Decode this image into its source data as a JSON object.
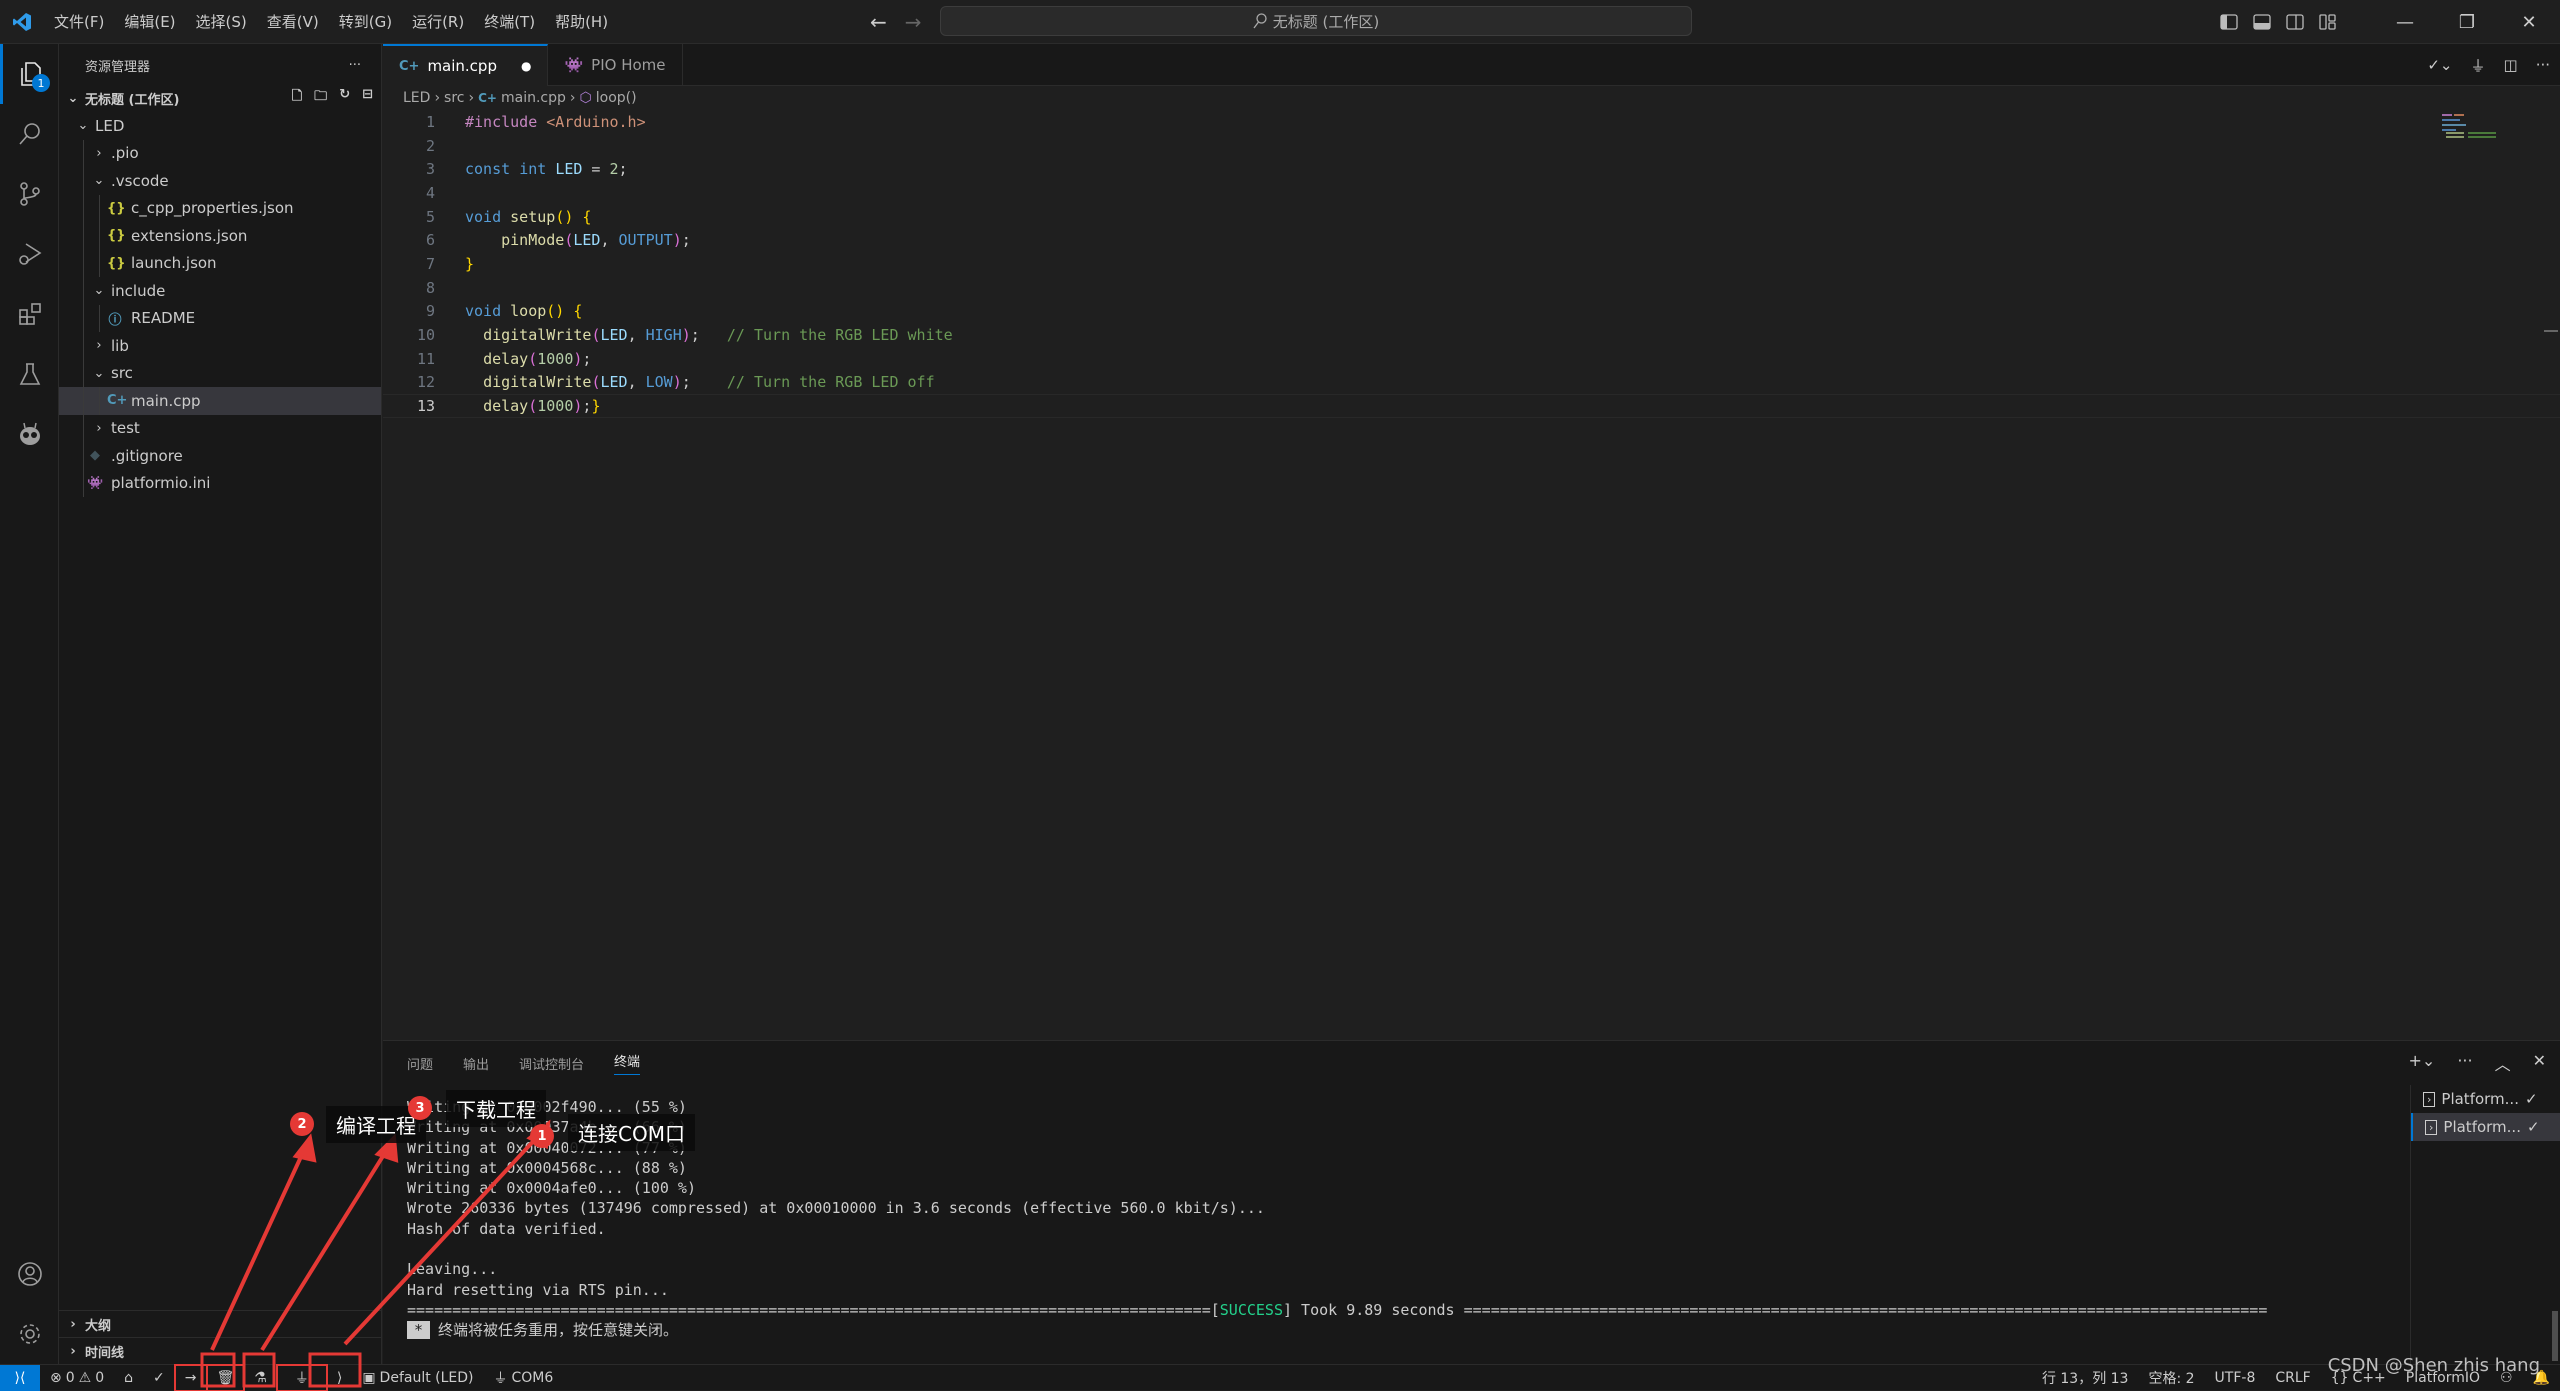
{
  "menu": [
    "文件(F)",
    "编辑(E)",
    "选择(S)",
    "查看(V)",
    "转到(G)",
    "运行(R)",
    "终端(T)",
    "帮助(H)"
  ],
  "command_center": "无标题 (工作区)",
  "sidebar": {
    "title": "资源管理器",
    "more": "···",
    "workspace": "无标题 (工作区)",
    "explorer_badge": "1",
    "tree": [
      {
        "label": "LED",
        "type": "folder",
        "open": true,
        "depth": 0
      },
      {
        "label": ".pio",
        "type": "folder",
        "open": false,
        "depth": 1
      },
      {
        "label": ".vscode",
        "type": "folder",
        "open": true,
        "depth": 1
      },
      {
        "label": "c_cpp_properties.json",
        "type": "json",
        "depth": 2
      },
      {
        "label": "extensions.json",
        "type": "json",
        "depth": 2
      },
      {
        "label": "launch.json",
        "type": "json",
        "depth": 2
      },
      {
        "label": "include",
        "type": "folder",
        "open": true,
        "depth": 1
      },
      {
        "label": "README",
        "type": "info",
        "depth": 2
      },
      {
        "label": "lib",
        "type": "folder",
        "open": false,
        "depth": 1
      },
      {
        "label": "src",
        "type": "folder",
        "open": true,
        "depth": 1
      },
      {
        "label": "main.cpp",
        "type": "cpp",
        "depth": 2,
        "selected": true
      },
      {
        "label": "test",
        "type": "folder",
        "open": false,
        "depth": 1
      },
      {
        "label": ".gitignore",
        "type": "git",
        "depth": 1
      },
      {
        "label": "platformio.ini",
        "type": "pio",
        "depth": 1
      }
    ],
    "sections": [
      "大纲",
      "时间线"
    ]
  },
  "tabs": [
    {
      "label": "main.cpp",
      "icon": "cpp",
      "dirty": true,
      "active": true
    },
    {
      "label": "PIO Home",
      "icon": "pio",
      "active": false
    }
  ],
  "breadcrumb": [
    "LED",
    "src",
    "main.cpp",
    "loop()"
  ],
  "code": {
    "current_line": 13,
    "lines": [
      [
        [
          "pp",
          "#include "
        ],
        [
          "str",
          "<Arduino.h>"
        ]
      ],
      [],
      [
        [
          "kw",
          "const "
        ],
        [
          "kw",
          "int "
        ],
        [
          "var",
          "LED"
        ],
        [
          "",
          "&nbsp;= "
        ],
        [
          "num",
          "2"
        ],
        [
          "",
          ";"
        ]
      ],
      [],
      [
        [
          "kw",
          "void "
        ],
        [
          "fn",
          "setup"
        ],
        [
          "br1",
          "() {"
        ]
      ],
      [
        [
          "",
          "    "
        ],
        [
          "fn",
          "pinMode"
        ],
        [
          "br2",
          "("
        ],
        [
          "var",
          "LED"
        ],
        [
          "",
          ", "
        ],
        [
          "mac",
          "OUTPUT"
        ],
        [
          "br2",
          ")"
        ],
        [
          "",
          ";"
        ]
      ],
      [
        [
          "br1",
          "}"
        ]
      ],
      [],
      [
        [
          "kw",
          "void "
        ],
        [
          "fn",
          "loop"
        ],
        [
          "br1",
          "() {"
        ]
      ],
      [
        [
          "",
          "  "
        ],
        [
          "fn",
          "digitalWrite"
        ],
        [
          "br2",
          "("
        ],
        [
          "var",
          "LED"
        ],
        [
          "",
          ", "
        ],
        [
          "mac",
          "HIGH"
        ],
        [
          "br2",
          ")"
        ],
        [
          "",
          ";   "
        ],
        [
          "com",
          "// Turn the RGB LED white"
        ]
      ],
      [
        [
          "",
          "  "
        ],
        [
          "fn",
          "delay"
        ],
        [
          "br2",
          "("
        ],
        [
          "num",
          "1000"
        ],
        [
          "br2",
          ")"
        ],
        [
          "",
          ";"
        ]
      ],
      [
        [
          "",
          "  "
        ],
        [
          "fn",
          "digitalWrite"
        ],
        [
          "br2",
          "("
        ],
        [
          "var",
          "LED"
        ],
        [
          "",
          ", "
        ],
        [
          "mac",
          "LOW"
        ],
        [
          "br2",
          ")"
        ],
        [
          "",
          ";    "
        ],
        [
          "com",
          "// Turn the RGB LED off"
        ]
      ],
      [
        [
          "",
          "  "
        ],
        [
          "fn",
          "delay"
        ],
        [
          "br2",
          "("
        ],
        [
          "num",
          "1000"
        ],
        [
          "br2",
          ")"
        ],
        [
          "",
          ";"
        ],
        [
          "br1",
          "}"
        ]
      ]
    ]
  },
  "panel": {
    "tabs": [
      "问题",
      "输出",
      "调试控制台",
      "终端"
    ],
    "active_tab": "终端",
    "terminal_lines": [
      "Writing at 0x0002f490... (55 %)",
      "Writing at 0x00037a4b... (66 %)",
      "Writing at 0x00040072... (77 %)",
      "Writing at 0x0004568c... (88 %)",
      "Writing at 0x0004afe0... (100 %)",
      "Wrote 260336 bytes (137496 compressed) at 0x00010000 in 3.6 seconds (effective 560.0 kbit/s)...",
      "Hash of data verified.",
      "",
      "Leaving...",
      "Hard resetting via RTS pin..."
    ],
    "success_left": "=========================================================================================",
    "success_tag": "SUCCESS",
    "success_text": " Took 9.89 seconds ",
    "success_right": "=========================================================================================",
    "reuse_prefix": "*",
    "reuse_text": "终端将被任务重用，按任意键关闭。",
    "terminal_list": [
      "Platform...",
      "Platform..."
    ]
  },
  "statusbar": {
    "errors": "0",
    "warnings": "0",
    "env": "Default (LED)",
    "port": "COM6",
    "position": "行 13，列 13",
    "spaces": "空格: 2",
    "encoding": "UTF-8",
    "eol": "CRLF",
    "language": "C++",
    "platform": "PlatformIO"
  },
  "annotations": [
    {
      "num": "2",
      "label": "编译工程"
    },
    {
      "num": "3",
      "label": "下载工程"
    },
    {
      "num": "1",
      "label": "连接COM口"
    }
  ],
  "watermark": "CSDN @Shen zhis hang",
  "colors": {
    "accent": "#0078d4",
    "annotation": "#e53935",
    "success": "#23d18b"
  }
}
